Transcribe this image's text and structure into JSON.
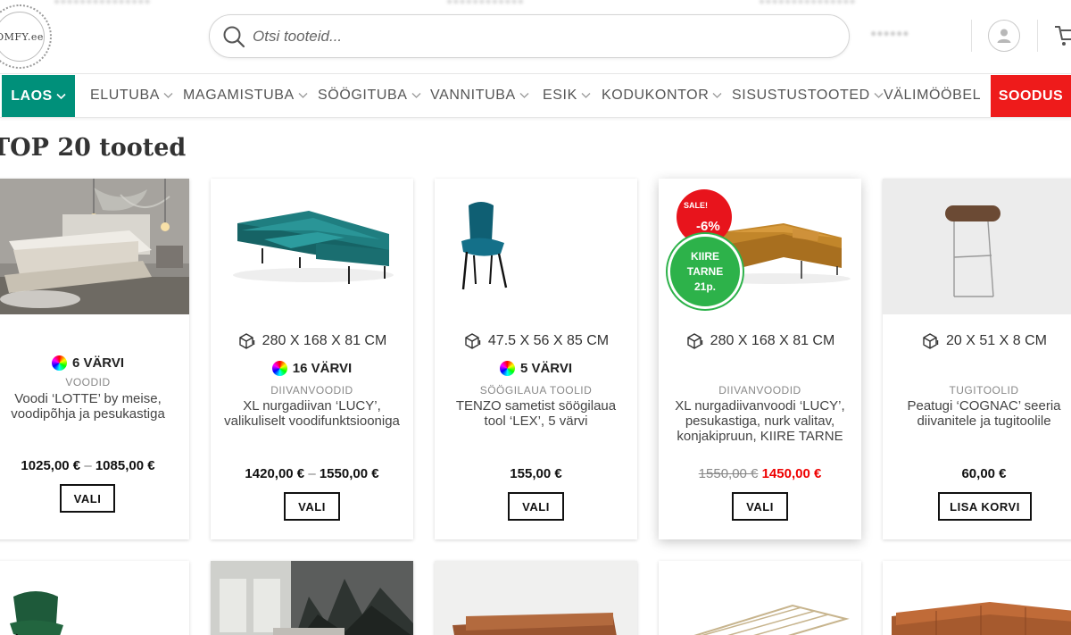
{
  "header": {
    "logo_text": "OMFY.ee",
    "search_placeholder": "Otsi tooteid..."
  },
  "nav": {
    "laos": "LAOS",
    "items": [
      "ELUTUBA",
      "MAGAMISTUBA",
      "SÖÖGITUBA",
      "VANNITUBA",
      "ESIK",
      "KODUKONTOR",
      "SISUSTUSTOOTED",
      "VÄLIMÖÖBEL"
    ],
    "soodus": "SOODUS"
  },
  "section_title": "TOP 20 tooted",
  "products": [
    {
      "colors": "6 VÄRVI",
      "category": "VOODID",
      "name": "Voodi ‘LOTTE’ by meise, voodipõhja ja pesukastiga",
      "price_from": "1025,00 €",
      "price_sep": "–",
      "price_to": "1085,00 €",
      "button": "VALI"
    },
    {
      "dimensions": "280 X 168 X 81 CM",
      "colors": "16 VÄRVI",
      "category": "DIIVANVOODID",
      "name": "XL nurgadiivan ‘LUCY’, valikuliselt voodifunktsiooniga",
      "price_from": "1420,00 €",
      "price_sep": "–",
      "price_to": "1550,00 €",
      "button": "VALI"
    },
    {
      "dimensions": "47.5 X 56 X 85 CM",
      "colors": "5 VÄRVI",
      "category": "SÖÖGILAUA TOOLID",
      "name": "TENZO sametist söögilaua tool ‘LEX’, 5 värvi",
      "price": "155,00 €",
      "button": "VALI"
    },
    {
      "badge_sale_label": "SALE!",
      "badge_sale_percent": "-6%",
      "badge_kiire_line1": "KIIRE",
      "badge_kiire_line2": "TARNE",
      "badge_kiire_line3": "21p.",
      "dimensions": "280 X 168 X 81 CM",
      "category": "DIIVANVOODID",
      "name": "XL nurgadiivanvoodi ‘LUCY’, pesukastiga, nurk valitav, konjakipruun, KIIRE TARNE",
      "price_old": "1550,00 €",
      "price_new": "1450,00 €",
      "button": "VALI"
    },
    {
      "dimensions": "20 X 51 X 8 CM",
      "category": "TUGITOOLID",
      "name": "Peatugi ‘COGNAC’ seeria diivanitele ja tugitoolile",
      "price": "60,00 €",
      "button": "LISA KORVI"
    }
  ],
  "colors": {
    "laos_bg": "#00907a",
    "soodus_bg": "#ee1b1b",
    "sale_badge": "#e8141c",
    "kiire_badge": "#2db24a",
    "new_price": "#e00000"
  }
}
